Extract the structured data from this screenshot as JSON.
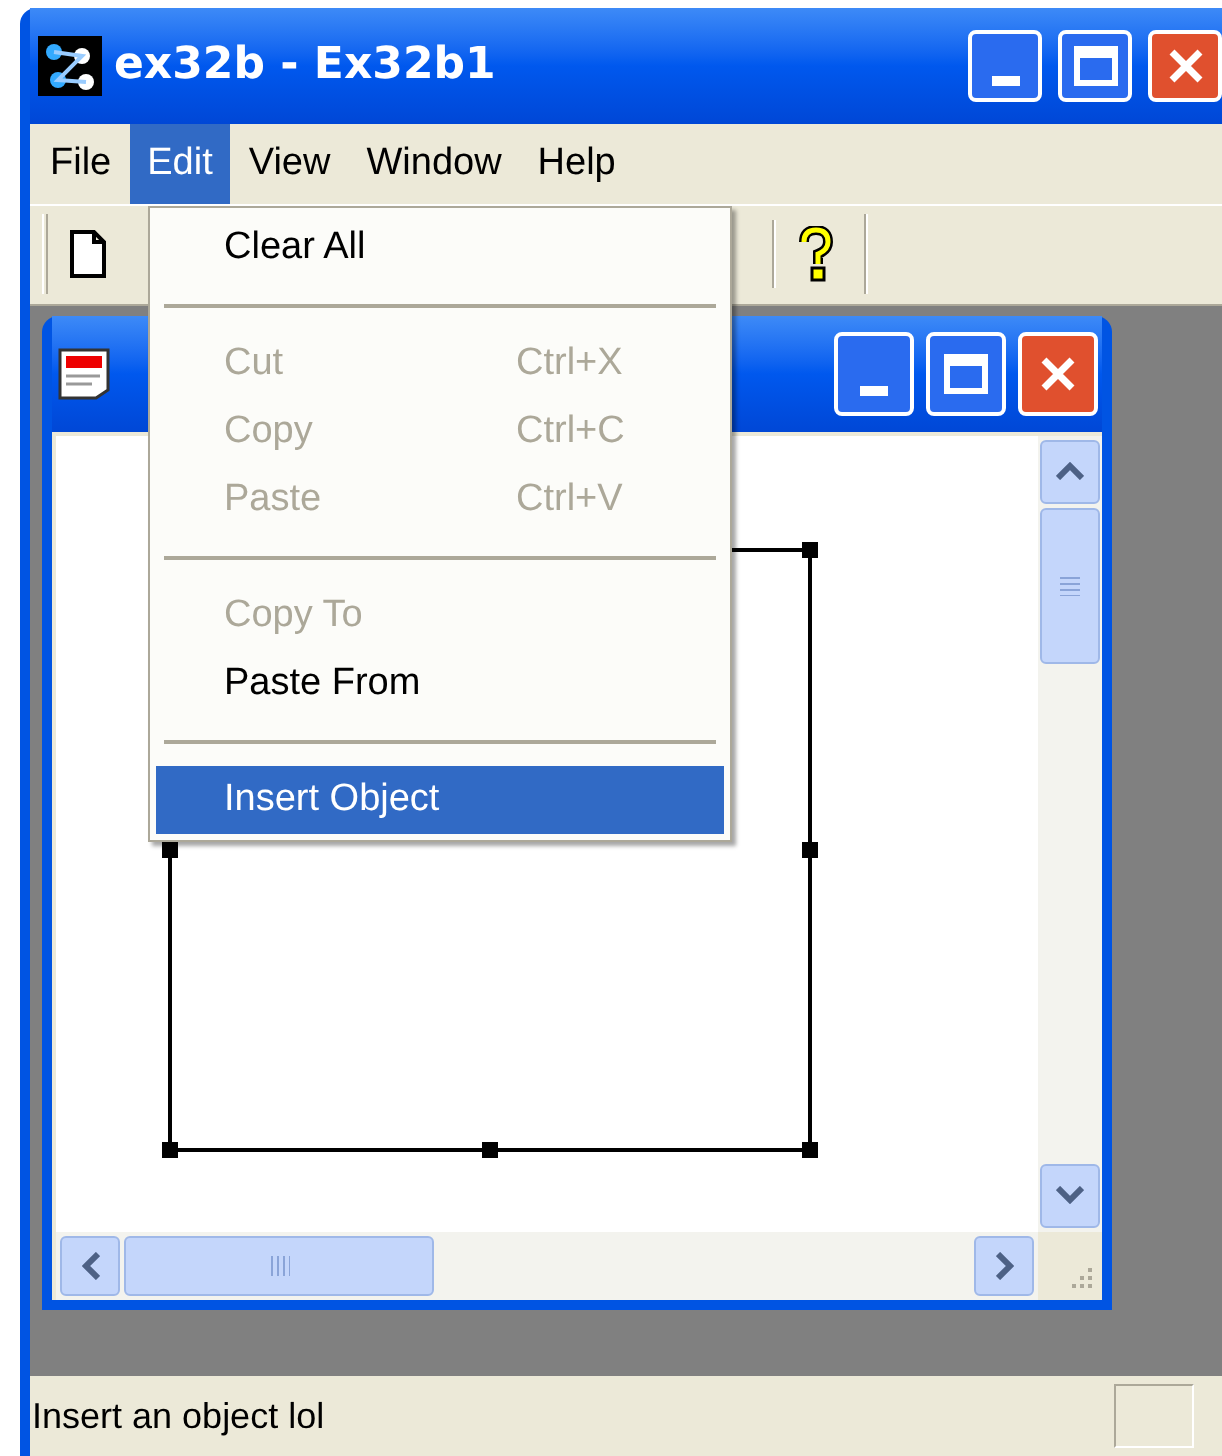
{
  "window": {
    "title": "ex32b - Ex32b1"
  },
  "menu_bar": [
    {
      "label": "File",
      "selected": false
    },
    {
      "label": "Edit",
      "selected": true
    },
    {
      "label": "View",
      "selected": false
    },
    {
      "label": "Window",
      "selected": false
    },
    {
      "label": "Help",
      "selected": false
    }
  ],
  "edit_menu": [
    {
      "kind": "item",
      "label": "Clear All",
      "disabled": false,
      "selected": false
    },
    {
      "kind": "separator"
    },
    {
      "kind": "item",
      "label": "Cut",
      "shortcut": "Ctrl+X",
      "disabled": true,
      "selected": false
    },
    {
      "kind": "item",
      "label": "Copy",
      "shortcut": "Ctrl+C",
      "disabled": true,
      "selected": false
    },
    {
      "kind": "item",
      "label": "Paste",
      "shortcut": "Ctrl+V",
      "disabled": true,
      "selected": false
    },
    {
      "kind": "separator"
    },
    {
      "kind": "item",
      "label": "Copy To",
      "disabled": true,
      "selected": false
    },
    {
      "kind": "item",
      "label": "Paste From",
      "disabled": false,
      "selected": false
    },
    {
      "kind": "separator"
    },
    {
      "kind": "item",
      "label": "Insert Object",
      "disabled": false,
      "selected": true
    }
  ],
  "status_bar": {
    "text": "Insert an object lol"
  }
}
